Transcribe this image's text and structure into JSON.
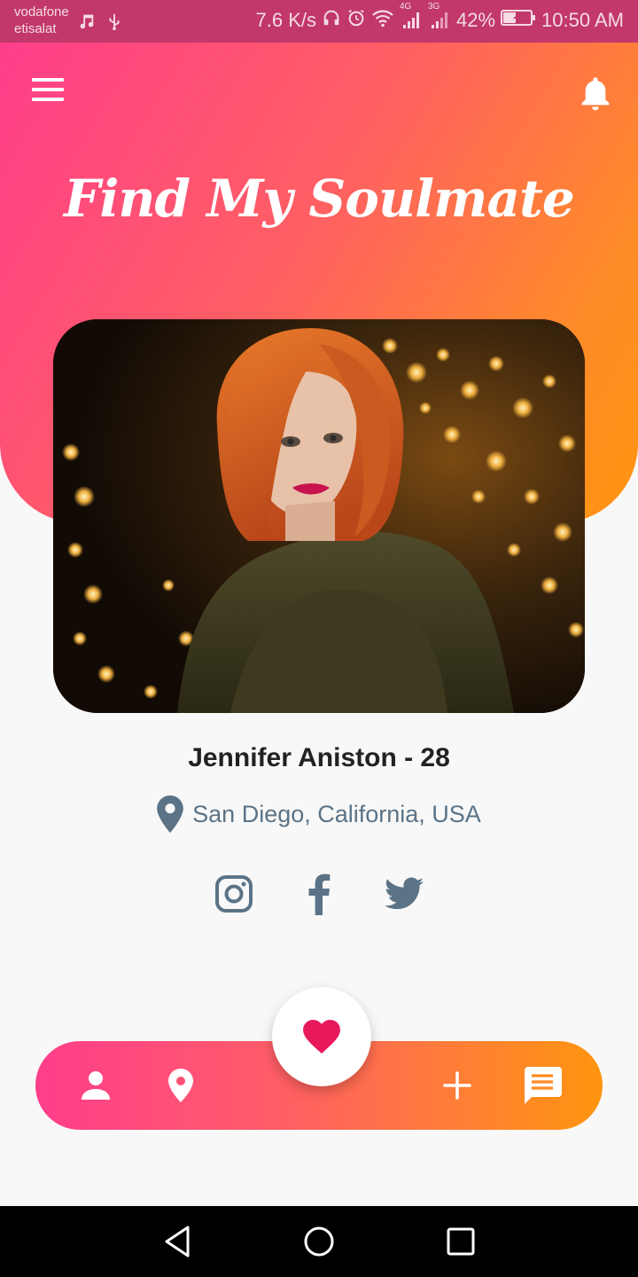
{
  "status_bar": {
    "carrier_line1": "vodafone",
    "carrier_line2": "etisalat",
    "net_speed": "7.6 K/s",
    "network_4g": "4G",
    "network_3g": "3G",
    "battery": "42%",
    "time": "10:50 AM",
    "icons": [
      "music-icon",
      "usb-icon",
      "headphones-icon",
      "alarm-icon",
      "wifi-icon",
      "signal-4g-icon",
      "signal-3g-icon",
      "battery-charging-icon"
    ]
  },
  "header": {
    "title": "Find My Soulmate",
    "menu_icon": "hamburger-menu-icon",
    "notification_icon": "bell-icon"
  },
  "profile": {
    "name": "Jennifer Aniston - 28",
    "location": "San Diego, California, USA",
    "location_icon": "map-pin-icon",
    "photo": "profile-photo",
    "socials": [
      "instagram-icon",
      "facebook-icon",
      "twitter-icon"
    ]
  },
  "bottom_nav": {
    "items": [
      "profile-icon",
      "location-icon",
      "heart-icon",
      "add-icon",
      "chat-icon"
    ]
  },
  "system_nav": {
    "items": [
      "back-icon",
      "home-icon",
      "recents-icon"
    ]
  },
  "colors": {
    "gradient_start": "#ff3e8b",
    "gradient_end": "#ff950f",
    "heart": "#e8195a",
    "text_dark": "#222222",
    "text_secondary": "#5b7386",
    "status_bar": "#c2386a"
  }
}
